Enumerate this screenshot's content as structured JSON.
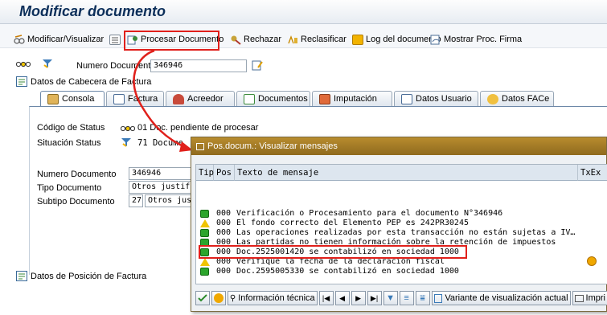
{
  "title": "Modificar documento",
  "toolbar": {
    "items": [
      {
        "label": "Modificar/Visualizar",
        "icon": "glasses-pencil-icon"
      },
      {
        "label": "",
        "icon": "list-icon"
      },
      {
        "label": "Procesar Documento",
        "icon": "process-icon"
      },
      {
        "label": "Rechazar",
        "icon": "reject-icon"
      },
      {
        "label": "Reclasificar",
        "icon": "reclassify-icon"
      },
      {
        "label": "Log del documento",
        "icon": "log-icon"
      },
      {
        "label": "Mostrar Proc. Firma",
        "icon": "signature-icon"
      }
    ]
  },
  "header": {
    "doc_number_label": "Numero Documento",
    "doc_number_value": "346946",
    "section_label": "Datos de Cabecera de Factura"
  },
  "tabs": [
    {
      "label": "Consola",
      "active": true
    },
    {
      "label": "Factura"
    },
    {
      "label": "Acreedor"
    },
    {
      "label": "Documentos"
    },
    {
      "label": "Imputación"
    },
    {
      "label": "Datos Usuario"
    },
    {
      "label": "Datos FACe"
    }
  ],
  "console": {
    "status_code_label": "Código de Status",
    "status_code_value": "01 Doc. pendiente de procesar",
    "status_situation_label": "Situación Status",
    "status_situation_value": "71 Docume",
    "doc_number_label": "Numero Documento",
    "doc_number_value": "346946",
    "doc_type_label": "Tipo Documento",
    "doc_type_value": "Otros justif. gas",
    "doc_subtype_label": "Subtipo Documento",
    "doc_subtype_code": "27",
    "doc_subtype_value": "Otros jus"
  },
  "position_section_label": "Datos de Posición de Factura",
  "dialog": {
    "title": "Pos.docum.: Visualizar mensajes",
    "columns": [
      "Tip",
      "Pos",
      "Texto de mensaje",
      "TxEx"
    ],
    "rows": [
      {
        "type": "success",
        "pos": "000",
        "text": "Verificación o Procesamiento para el documento N°346946",
        "txex": ""
      },
      {
        "type": "warning",
        "pos": "000",
        "text": "El fondo correcto del Elemento PEP es 242PR30245",
        "txex": ""
      },
      {
        "type": "success",
        "pos": "000",
        "text": "Las operaciones realizadas por esta transacción no están sujetas a IV…",
        "txex": ""
      },
      {
        "type": "success",
        "pos": "000",
        "text": "Las partidas no tienen información sobre la retención de impuestos",
        "txex": ""
      },
      {
        "type": "success",
        "pos": "000",
        "text": "Doc.2525001420 se contabilizó en sociedad 1000",
        "txex": "",
        "highlighted": true
      },
      {
        "type": "warning",
        "pos": "000",
        "text": "Verifique la fecha de la declaración fiscal",
        "txex": "info"
      },
      {
        "type": "success",
        "pos": "000",
        "text": "Doc.2595005330 se contabilizó en sociedad 1000",
        "txex": ""
      }
    ],
    "footer": {
      "tech_info_label": "Información técnica",
      "display_variant_label": "Variante de visualización actual",
      "print_label": "Impri"
    }
  }
}
